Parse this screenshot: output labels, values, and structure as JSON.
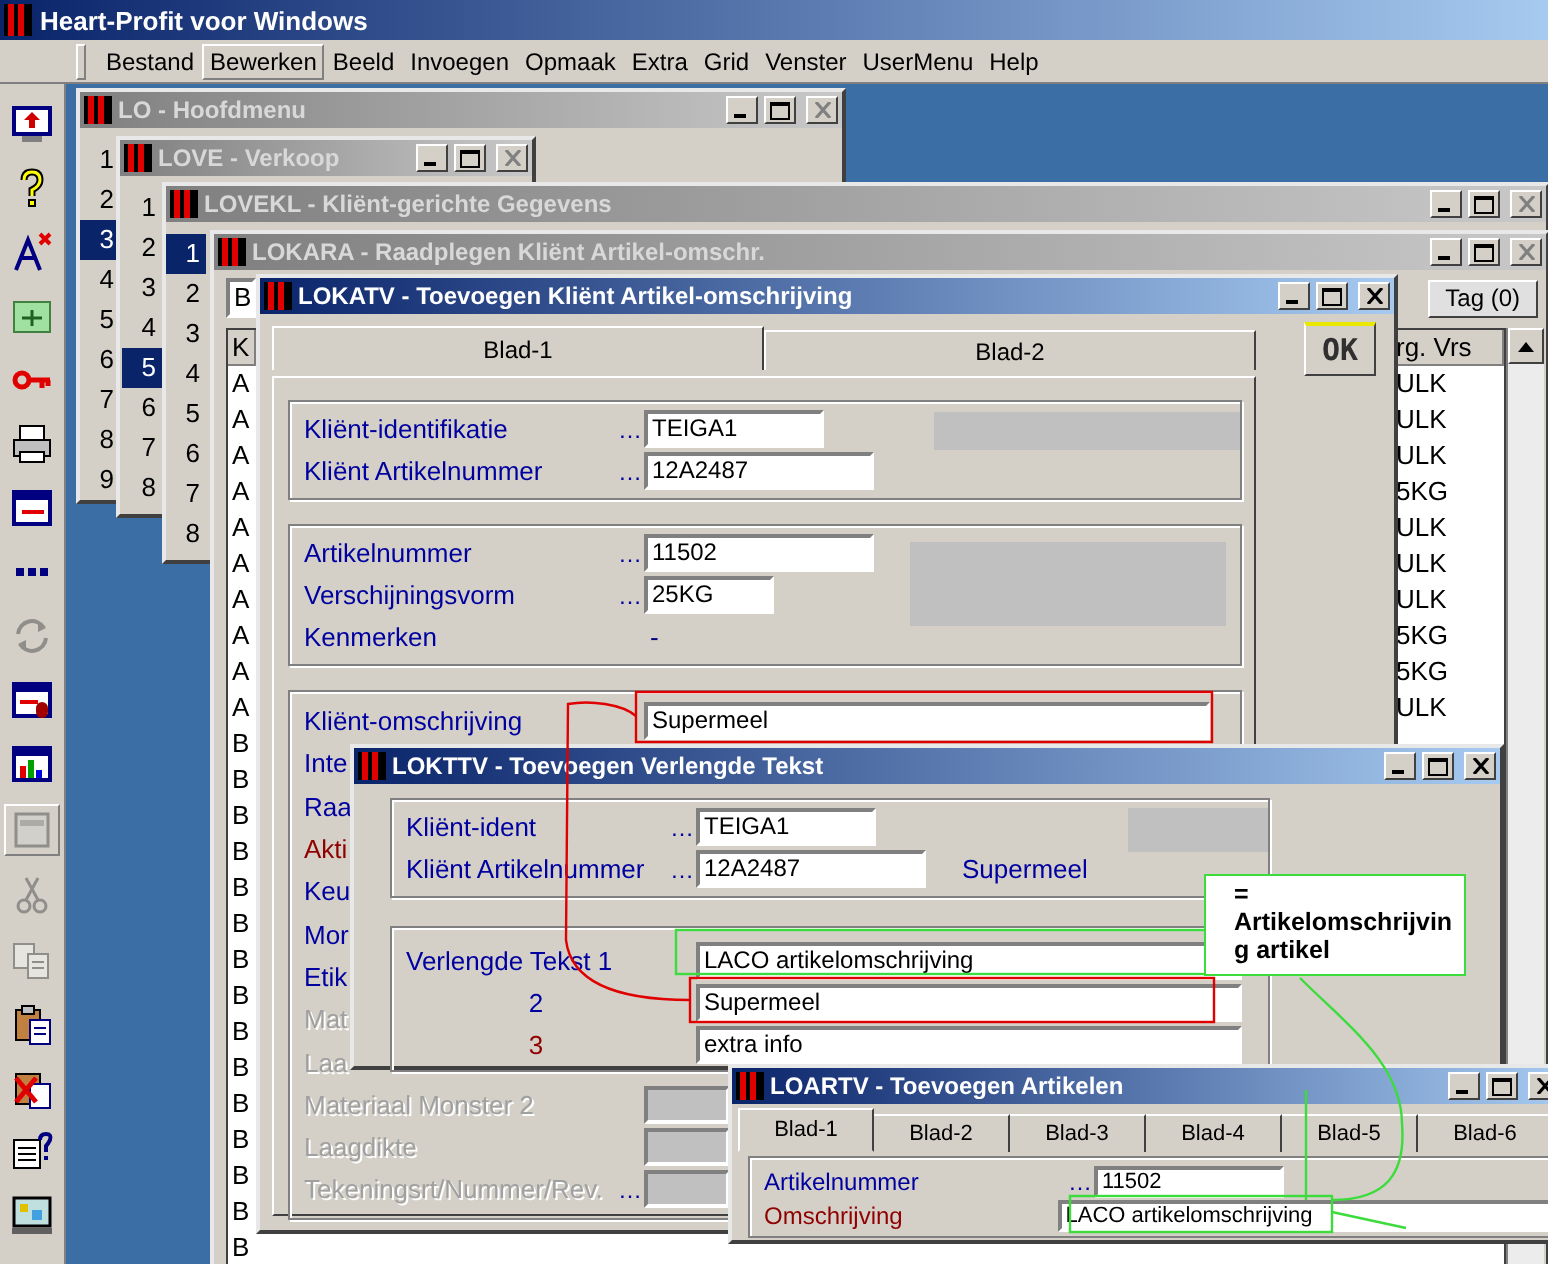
{
  "app": {
    "title": "Heart-Profit voor Windows"
  },
  "menu": [
    {
      "label": "Bestand",
      "selected": false
    },
    {
      "label": "Bewerken",
      "selected": true
    },
    {
      "label": "Beeld",
      "selected": false
    },
    {
      "label": "Invoegen",
      "selected": false
    },
    {
      "label": "Opmaak",
      "selected": false
    },
    {
      "label": "Extra",
      "selected": false
    },
    {
      "label": "Grid",
      "selected": false
    },
    {
      "label": "Venster",
      "selected": false
    },
    {
      "label": "UserMenu",
      "selected": false
    },
    {
      "label": "Help",
      "selected": false
    }
  ],
  "toolbar": [
    {
      "disabled": false,
      "pressed": false
    },
    {
      "disabled": false,
      "pressed": false
    },
    {
      "disabled": false,
      "pressed": false
    },
    {
      "disabled": false,
      "pressed": false
    },
    {
      "disabled": false,
      "pressed": false
    },
    {
      "disabled": false,
      "pressed": false
    },
    {
      "disabled": false,
      "pressed": false
    },
    {
      "disabled": false,
      "pressed": false
    },
    {
      "disabled": true,
      "pressed": false
    },
    {
      "disabled": false,
      "pressed": false
    },
    {
      "disabled": false,
      "pressed": false
    },
    {
      "disabled": true,
      "pressed": true
    },
    {
      "disabled": true,
      "pressed": false
    },
    {
      "disabled": true,
      "pressed": false
    },
    {
      "disabled": false,
      "pressed": false
    },
    {
      "disabled": false,
      "pressed": false
    },
    {
      "disabled": false,
      "pressed": false
    },
    {
      "disabled": false,
      "pressed": false
    }
  ],
  "main_menu_window": {
    "title": "LO - Hoofdmenu",
    "active": false,
    "items": [
      {
        "label": "1",
        "selected": false
      },
      {
        "label": "2",
        "selected": false
      },
      {
        "label": "3",
        "selected": true
      },
      {
        "label": "4",
        "selected": false
      },
      {
        "label": "5",
        "selected": false
      },
      {
        "label": "6",
        "selected": false
      },
      {
        "label": "7",
        "selected": false
      },
      {
        "label": "8",
        "selected": false
      },
      {
        "label": "9",
        "selected": false
      }
    ]
  },
  "sales_window": {
    "title": "LOVE - Verkoop",
    "active": false,
    "items": [
      {
        "label": "1",
        "selected": false
      },
      {
        "label": "2",
        "selected": false
      },
      {
        "label": "3",
        "selected": false
      },
      {
        "label": "4",
        "selected": false
      },
      {
        "label": "5",
        "selected": true
      },
      {
        "label": "6",
        "selected": false
      },
      {
        "label": "7",
        "selected": false
      },
      {
        "label": "8",
        "selected": false
      }
    ]
  },
  "client_window": {
    "title": "LOVEKL - Kliënt-gerichte Gegevens",
    "active": false,
    "items": [
      {
        "label": "1",
        "selected": true
      },
      {
        "label": "2",
        "selected": false
      },
      {
        "label": "3",
        "selected": false
      },
      {
        "label": "4",
        "selected": false
      },
      {
        "label": "5",
        "selected": false
      },
      {
        "label": "6",
        "selected": false
      },
      {
        "label": "7",
        "selected": false
      },
      {
        "label": "8",
        "selected": false
      }
    ]
  },
  "lookup_window": {
    "title": "LOKARA - Raadplegen Kliënt Artikel-omschr.",
    "active": false,
    "search_value": "B",
    "tag_button": "Tag (0)",
    "columns": [
      "K",
      "rg. Vrs"
    ],
    "rows": [
      {
        "code": "A",
        "org": "ULK"
      },
      {
        "code": "A",
        "org": "ULK"
      },
      {
        "code": "A",
        "org": "ULK"
      },
      {
        "code": "A",
        "org": "5KG"
      },
      {
        "code": "A",
        "org": "ULK"
      },
      {
        "code": "A",
        "org": "ULK"
      },
      {
        "code": "A",
        "org": "ULK"
      },
      {
        "code": "A",
        "org": "5KG"
      },
      {
        "code": "A",
        "org": "5KG"
      },
      {
        "code": "A",
        "org": "ULK"
      },
      {
        "code": "B"
      },
      {
        "code": "B"
      },
      {
        "code": "B"
      },
      {
        "code": "B"
      },
      {
        "code": "B"
      },
      {
        "code": "B"
      },
      {
        "code": "B"
      },
      {
        "code": "B"
      },
      {
        "code": "B"
      },
      {
        "code": "B"
      },
      {
        "code": "B"
      },
      {
        "code": "B"
      },
      {
        "code": "B"
      },
      {
        "code": "B"
      },
      {
        "code": "B"
      }
    ]
  },
  "entry_window": {
    "title": "LOKATV - Toevoegen Kliënt Artikel-omschrijving",
    "active": true,
    "tabs": [
      {
        "label": "Blad-1",
        "selected": true
      },
      {
        "label": "Blad-2",
        "selected": false
      }
    ],
    "ok_button": "OK",
    "groups": [
      {
        "rows": [
          {
            "label": "Kliënt-identifikatie",
            "lookup": "…",
            "value": "TEIGA1",
            "kind": "small",
            "required": false,
            "disabled": false
          },
          {
            "label": "Kliënt Artikelnummer",
            "lookup": "…",
            "value": "12A2487",
            "kind": "medium",
            "required": false,
            "disabled": false
          }
        ]
      },
      {
        "rows": [
          {
            "label": "Artikelnummer",
            "lookup": "…",
            "value": "11502",
            "kind": "medium",
            "required": false,
            "disabled": false
          },
          {
            "label": "Verschijningsvorm",
            "lookup": "…",
            "value": "25KG",
            "kind": "short",
            "required": false,
            "disabled": false
          },
          {
            "label": "Kenmerken",
            "value": "-",
            "kind": "text",
            "required": false,
            "disabled": false
          }
        ]
      },
      {
        "rows": [
          {
            "label": "Kliënt-omschrijving",
            "value": "Supermeel",
            "kind": "long",
            "required": false,
            "disabled": false
          },
          {
            "label": "Inte",
            "kind": "label",
            "required": false,
            "disabled": false
          },
          {
            "label": "Raa",
            "kind": "label",
            "required": false,
            "disabled": false
          },
          {
            "label": "Akti",
            "kind": "label",
            "required": true,
            "disabled": false
          },
          {
            "label": "Keu",
            "kind": "label",
            "required": false,
            "disabled": false
          },
          {
            "label": "Mor",
            "kind": "label",
            "required": false,
            "disabled": false
          },
          {
            "label": "Etik",
            "kind": "label",
            "required": false,
            "disabled": false
          },
          {
            "label": "Mat",
            "kind": "label",
            "required": false,
            "disabled": true
          },
          {
            "label": "Laa",
            "kind": "label",
            "required": false,
            "disabled": true
          },
          {
            "label": "Materiaal Monster 2",
            "kind": "stub",
            "required": false,
            "disabled": true
          },
          {
            "label": "Laagdikte",
            "kind": "stub",
            "required": false,
            "disabled": true
          },
          {
            "label": "Tekeningsrt/Nummer/Rev.",
            "lookup": "…",
            "kind": "stub",
            "required": false,
            "disabled": true
          }
        ]
      }
    ]
  },
  "text_window": {
    "title": "LOKTTV - Toevoegen Verlengde Tekst",
    "active": true,
    "rows": [
      {
        "label": "Kliënt-ident",
        "lookup": "…",
        "value": "TEIGA1",
        "kind": "small",
        "required": false,
        "disabled": false
      },
      {
        "label": "Kliënt Artikelnummer",
        "lookup": "…",
        "value": "12A2487",
        "kind": "medium",
        "note": "Supermeel",
        "required": false,
        "disabled": false
      }
    ],
    "text_lines": [
      {
        "label": "Verlengde Tekst 1",
        "value": "LACO artikelomschrijving",
        "required": false
      },
      {
        "label": "2",
        "value": "Supermeel",
        "required": false
      },
      {
        "label": "3",
        "value": "extra info",
        "required": true
      }
    ],
    "annotation": "= Artikelomschrijving artikel"
  },
  "article_window": {
    "title": "LOARTV - Toevoegen Artikelen",
    "active": true,
    "tabs": [
      {
        "label": "Blad-1",
        "selected": true
      },
      {
        "label": "Blad-2",
        "selected": false
      },
      {
        "label": "Blad-3",
        "selected": false
      },
      {
        "label": "Blad-4",
        "selected": false
      },
      {
        "label": "Blad-5",
        "selected": false
      },
      {
        "label": "Blad-6",
        "selected": false
      }
    ],
    "rows": [
      {
        "label": "Artikelnummer",
        "lookup": "…",
        "value": "11502",
        "kind": "medium",
        "required": false,
        "disabled": false
      },
      {
        "label": "Omschrijving",
        "value": "LACO artikelomschrijving",
        "kind": "long",
        "required": true,
        "disabled": false
      }
    ]
  }
}
